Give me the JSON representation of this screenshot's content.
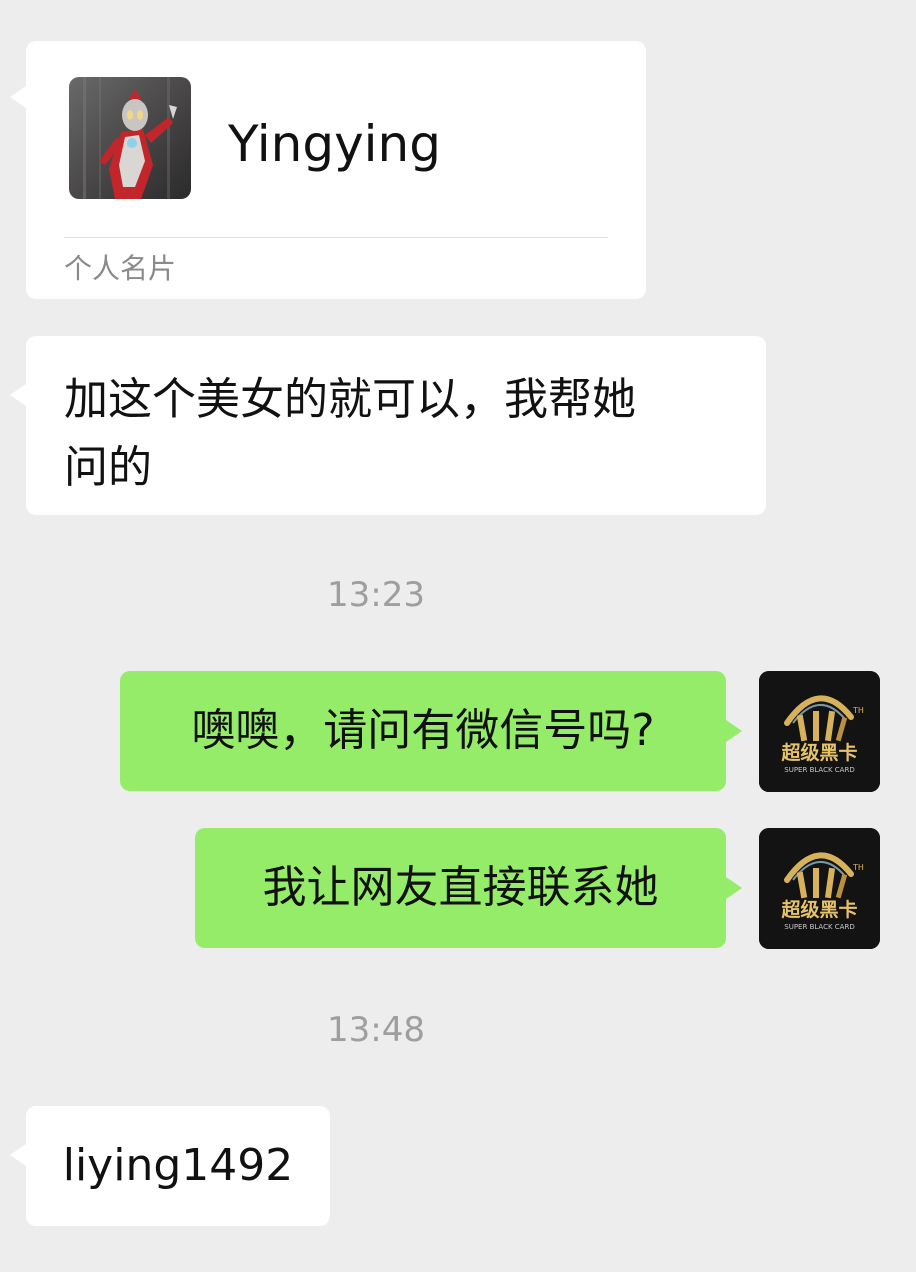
{
  "contact_card": {
    "name": "Yingying",
    "label": "个人名片",
    "avatar": "superhero-figure-avatar"
  },
  "messages": [
    {
      "id": "msg1",
      "direction": "incoming",
      "lines": [
        "加这个美女的就可以，我帮她",
        "问的"
      ]
    },
    {
      "id": "msg2",
      "direction": "outgoing",
      "text": "噢噢，请问有微信号吗?"
    },
    {
      "id": "msg3",
      "direction": "outgoing",
      "text": "我让网友直接联系她"
    },
    {
      "id": "msg4",
      "direction": "incoming",
      "text": "liying1492"
    }
  ],
  "timestamps": [
    "13:23",
    "13:48"
  ],
  "my_avatar": {
    "title": "超级黑卡",
    "subtitle": "SUPER BLACK CARD",
    "mark": "TH"
  },
  "colors": {
    "background": "#ededed",
    "incoming_bubble": "#ffffff",
    "outgoing_bubble": "#95ec69",
    "timestamp_text": "#9e9e9e",
    "avatar_gold": "#d8b25a"
  }
}
